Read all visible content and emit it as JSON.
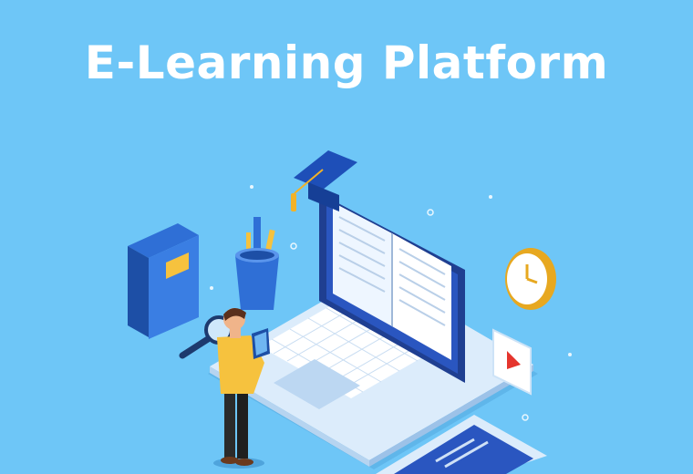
{
  "header": {
    "title": "E-Learning Platform"
  },
  "colors": {
    "background": "#6ec6f7",
    "title": "#ffffff",
    "accent_blue": "#2f6fd6",
    "accent_yellow": "#f6c23e"
  },
  "icons": [
    "graduation-cap-icon",
    "book-icon",
    "pencil-cup-icon",
    "magnifier-icon",
    "clock-icon",
    "video-play-icon",
    "laptop-icon",
    "tablet-icon",
    "person-icon"
  ]
}
